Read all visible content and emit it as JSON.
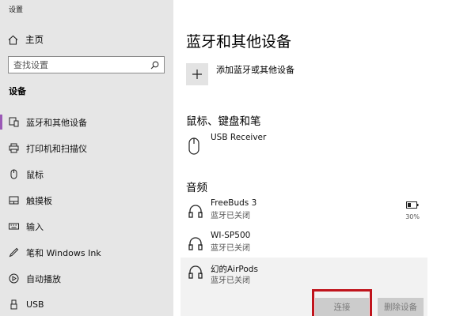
{
  "window": {
    "title": "设置"
  },
  "sidebar": {
    "home_label": "主页",
    "search_placeholder": "查找设置",
    "section_title": "设备",
    "items": [
      {
        "label": "蓝牙和其他设备",
        "icon": "bluetooth-devices-icon"
      },
      {
        "label": "打印机和扫描仪",
        "icon": "printer-icon"
      },
      {
        "label": "鼠标",
        "icon": "mouse-icon"
      },
      {
        "label": "触摸板",
        "icon": "touchpad-icon"
      },
      {
        "label": "输入",
        "icon": "keyboard-icon"
      },
      {
        "label": "笔和 Windows Ink",
        "icon": "pen-icon"
      },
      {
        "label": "自动播放",
        "icon": "autoplay-icon"
      },
      {
        "label": "USB",
        "icon": "usb-icon"
      }
    ]
  },
  "main": {
    "title": "蓝牙和其他设备",
    "add_device_label": "添加蓝牙或其他设备",
    "groups": {
      "input_title": "鼠标、键盘和笔",
      "audio_title": "音频"
    },
    "input_devices": [
      {
        "name": "USB Receiver",
        "status": ""
      }
    ],
    "audio_devices": [
      {
        "name": "FreeBuds 3",
        "status": "蓝牙已关闭",
        "battery": "30%"
      },
      {
        "name": "WI-SP500",
        "status": "蓝牙已关闭"
      },
      {
        "name": "幻的AirPods",
        "status": "蓝牙已关闭"
      }
    ],
    "buttons": {
      "connect": "连接",
      "remove": "删除设备"
    }
  },
  "colors": {
    "accent": "#9b59b6",
    "highlight": "#c0141c",
    "sidebar_bg": "#e6e6e6"
  }
}
